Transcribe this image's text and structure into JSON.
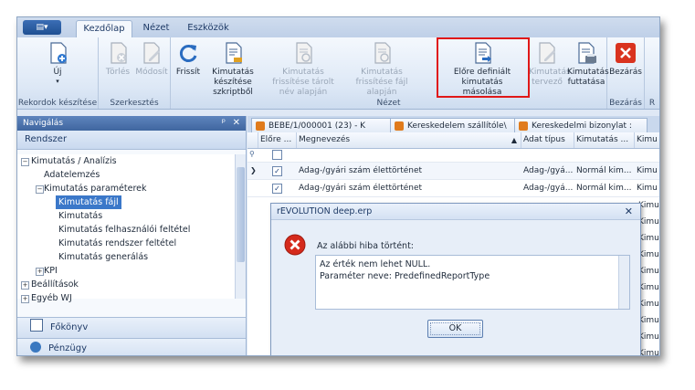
{
  "ribbon": {
    "app_menu_label": "▤▾",
    "tabs": [
      {
        "label": "Kezdőlap",
        "active": true
      },
      {
        "label": "Nézet",
        "active": false
      },
      {
        "label": "Eszközök",
        "active": false
      }
    ],
    "groups": {
      "rekordok": {
        "label": "Rekordok készítése",
        "buttons": [
          {
            "label": "Új",
            "icon": "new-document-icon",
            "enabled": true
          }
        ]
      },
      "szerkesztes": {
        "label": "Szerkesztés",
        "buttons": [
          {
            "label": "Törlés",
            "icon": "delete-document-icon",
            "enabled": false
          },
          {
            "label": "Módosít",
            "icon": "edit-document-icon",
            "enabled": false
          }
        ]
      },
      "nezet": {
        "label": "Nézet",
        "buttons": [
          {
            "label": "Frissít",
            "icon": "refresh-icon",
            "enabled": true
          },
          {
            "label": "Kimutatás készítése szkriptből",
            "icon": "script-report-icon",
            "enabled": true
          },
          {
            "label": "Kimutatás frissítése tárolt név alapján",
            "icon": "refresh-report-icon",
            "enabled": false
          },
          {
            "label": "Kimutatás frissítése fájl alapján",
            "icon": "refresh-file-report-icon",
            "enabled": false
          },
          {
            "label": "Előre definiált kimutatás másolása",
            "icon": "copy-report-icon",
            "enabled": true
          },
          {
            "label": "Kimutatás tervező",
            "icon": "report-designer-icon",
            "enabled": false
          },
          {
            "label": "Kimutatás futtatása",
            "icon": "run-report-icon",
            "enabled": true
          }
        ]
      },
      "bezaras": {
        "label": "Bezárás",
        "buttons": [
          {
            "label": "Bezárás",
            "icon": "close-red-icon",
            "enabled": true
          }
        ]
      },
      "extra": {
        "label": "R"
      }
    }
  },
  "nav": {
    "title": "Navigálás",
    "pin": "ᵖ",
    "close": "✕",
    "section": "Rendszer",
    "tree": [
      {
        "label": "Kimutatás / Analízis",
        "level": 0,
        "toggle": "−"
      },
      {
        "label": "Adatelemzés",
        "level": 1
      },
      {
        "label": "Kimutatás paraméterek",
        "level": 1,
        "toggle": "−"
      },
      {
        "label": "Kimutatás fájl",
        "level": 2,
        "selected": true
      },
      {
        "label": "Kimutatás",
        "level": 2
      },
      {
        "label": "Kimutatás felhasználói feltétel",
        "level": 2
      },
      {
        "label": "Kimutatás rendszer feltétel",
        "level": 2
      },
      {
        "label": "Kimutatás generálás",
        "level": 2
      },
      {
        "label": "KPI",
        "level": 1,
        "toggle": "+"
      },
      {
        "label": "Beállítások",
        "level": 0,
        "toggle": "+"
      },
      {
        "label": "Egyéb WJ",
        "level": 0,
        "toggle": "+"
      }
    ],
    "bottom_buttons": [
      {
        "label": "Főkönyv",
        "icon": "ledger-icon"
      },
      {
        "label": "Pénzügy",
        "icon": "finance-icon"
      }
    ]
  },
  "doc_tabs": [
    {
      "label": "BEBE/1/000001 (23) - K"
    },
    {
      "label": "Kereskedelem szállítóle\\"
    },
    {
      "label": "Kereskedelmi bizonylat :"
    }
  ],
  "grid": {
    "columns": [
      "Előre ...",
      "Megnevezés",
      "Adat típus",
      "Kimutatás ...",
      "Kimu"
    ],
    "sort_indicator": "▲",
    "rows": [
      {
        "checked": true,
        "name": "Adag-/gyári szám élettörténet",
        "type": "Adag-/gyá...",
        "kind": "Normál kim...",
        "extra": "Kimu",
        "current": true
      },
      {
        "checked": true,
        "name": "Adag-/gyári szám élettörténet",
        "type": "Adag-/gyá...",
        "kind": "Normál kim...",
        "extra": "Kimu",
        "current": false
      }
    ],
    "side_labels": [
      "Kimu",
      "Kimu",
      "Kimu",
      "Kimu",
      "Kimu",
      "Kimu",
      "Kimu",
      "Kimu",
      "Kimu",
      "Kimu"
    ]
  },
  "dialog": {
    "title": "rEVOLUTION deep.erp",
    "close": "✕",
    "icon": "error-icon",
    "message": "Az alábbi hiba történt:",
    "details": [
      "Az érték nem lehet NULL.",
      "Paraméter neve: PredefinedReportType"
    ],
    "ok_label": "OK"
  }
}
